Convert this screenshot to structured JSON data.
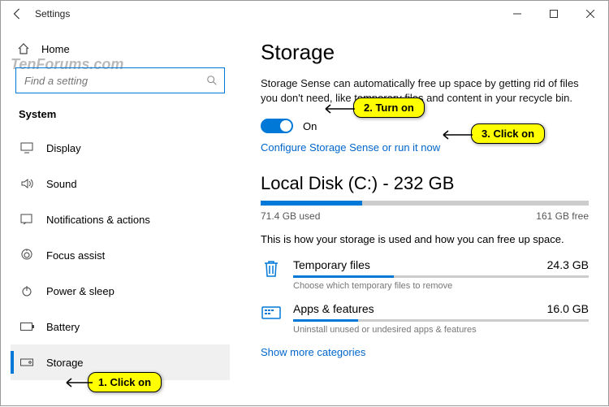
{
  "window": {
    "title": "Settings"
  },
  "watermark": "TenForums.com",
  "sidebar": {
    "home": "Home",
    "search_placeholder": "Find a setting",
    "section": "System",
    "items": [
      {
        "label": "Display"
      },
      {
        "label": "Sound"
      },
      {
        "label": "Notifications & actions"
      },
      {
        "label": "Focus assist"
      },
      {
        "label": "Power & sleep"
      },
      {
        "label": "Battery"
      },
      {
        "label": "Storage"
      }
    ]
  },
  "main": {
    "heading": "Storage",
    "description": "Storage Sense can automatically free up space by getting rid of files you don't need, like temporary files and content in your recycle bin.",
    "toggle_label": "On",
    "configure_link": "Configure Storage Sense or run it now",
    "disk_title": "Local Disk (C:) - 232 GB",
    "disk_used": "71.4 GB used",
    "disk_free": "161 GB free",
    "disk_pct": 31,
    "explain": "This is how your storage is used and how you can free up space.",
    "categories": [
      {
        "name": "Temporary files",
        "size": "24.3 GB",
        "sub": "Choose which temporary files to remove",
        "pct": 34
      },
      {
        "name": "Apps & features",
        "size": "16.0 GB",
        "sub": "Uninstall unused or undesired apps & features",
        "pct": 22
      }
    ],
    "show_more": "Show more categories"
  },
  "callouts": {
    "c1": "1. Click on",
    "c2": "2. Turn on",
    "c3": "3. Click on"
  }
}
